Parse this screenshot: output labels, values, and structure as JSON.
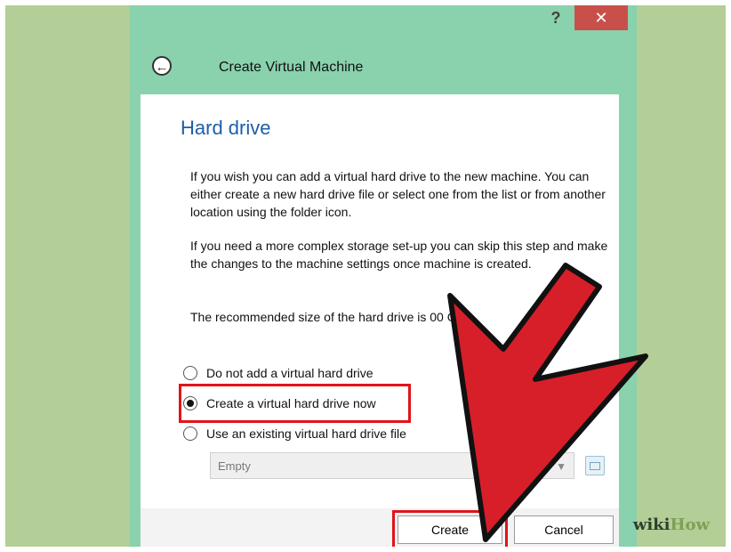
{
  "window": {
    "help_label": "?",
    "close_label": "✕",
    "title": "Create Virtual Machine",
    "back_label": "←"
  },
  "content": {
    "heading": "Hard drive",
    "paragraph1": "If you wish you can add a virtual hard drive to the new machine. You can either create a new hard drive file or select one from the list or from another location using the folder icon.",
    "paragraph2": "If you need a more complex storage set-up you can skip this step and make the changes to the machine settings once machine is created.",
    "paragraph3": "The recommended size of the hard drive is 00 GB",
    "options": [
      {
        "label": "Do not add a virtual hard drive",
        "checked": false
      },
      {
        "label": "Create a virtual hard drive now",
        "checked": true
      },
      {
        "label": "Use an existing virtual hard drive file",
        "checked": false
      }
    ],
    "dropdown_value": "Empty"
  },
  "buttons": {
    "create": "Create",
    "cancel": "Cancel"
  },
  "watermark": {
    "wiki": "wiki",
    "how": "How"
  },
  "colors": {
    "title_bar": "#89d2ad",
    "highlight": "#e0141a",
    "arrow": "#d71f2a"
  }
}
